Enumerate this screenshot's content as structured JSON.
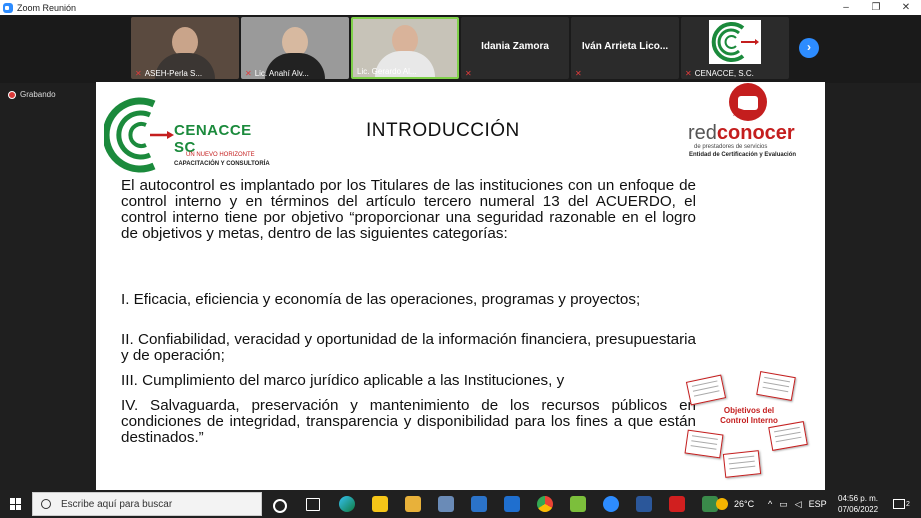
{
  "window": {
    "title": "Zoom Reunión",
    "controls": [
      "–",
      "❐",
      "✕"
    ]
  },
  "participants": [
    {
      "name": "ASEH-Perla S..."
    },
    {
      "name": "Lic. Anahí Alv..."
    },
    {
      "name": "Lic. Gerardo Al..."
    },
    {
      "name": "Idania Zamora"
    },
    {
      "name": "Iván Arrieta Lico..."
    },
    {
      "name": "CENACCE, S.C."
    }
  ],
  "recording": {
    "label": "Grabando"
  },
  "slide": {
    "title": "INTRODUCCIÓN",
    "logo_left": {
      "brand": "CENACCE SC",
      "tagline": "UN NUEVO HORIZONTE",
      "subtitle": "CAPACITACIÓN Y CONSULTORÍA"
    },
    "logo_right": {
      "word_a": "red",
      "word_b": "conocer",
      "sub1": "de prestadores de servicios",
      "sub2": "Entidad de Certificación y Evaluación"
    },
    "intro": "El autocontrol es implantado por los Titulares de las instituciones con un enfoque de control interno y en términos del artículo tercero numeral 13 del ACUERDO, el control interno tiene por objetivo “proporcionar una seguridad razonable en el logro de objetivos y metas, dentro de las siguientes categorías:",
    "items": [
      "I. Eficacia, eficiencia y economía de las operaciones, programas y proyectos;",
      "II. Confiabilidad, veracidad y oportunidad de la información financiera, presupuestaria y de operación;",
      "III. Cumplimiento del marco jurídico aplicable a las Instituciones, y",
      "IV. Salvaguarda, preservación y mantenimiento de los recursos públicos en condiciones de integridad, transparencia y disponibilidad para los fines a que están destinados.”"
    ],
    "graphic_label": "Objetivos del Control Interno"
  },
  "taskbar": {
    "search_placeholder": "Escribe aquí para buscar",
    "weather": "26°C",
    "language": "ESP",
    "time": "04:56 p. m.",
    "date": "07/06/2022",
    "notification_count": "2"
  }
}
